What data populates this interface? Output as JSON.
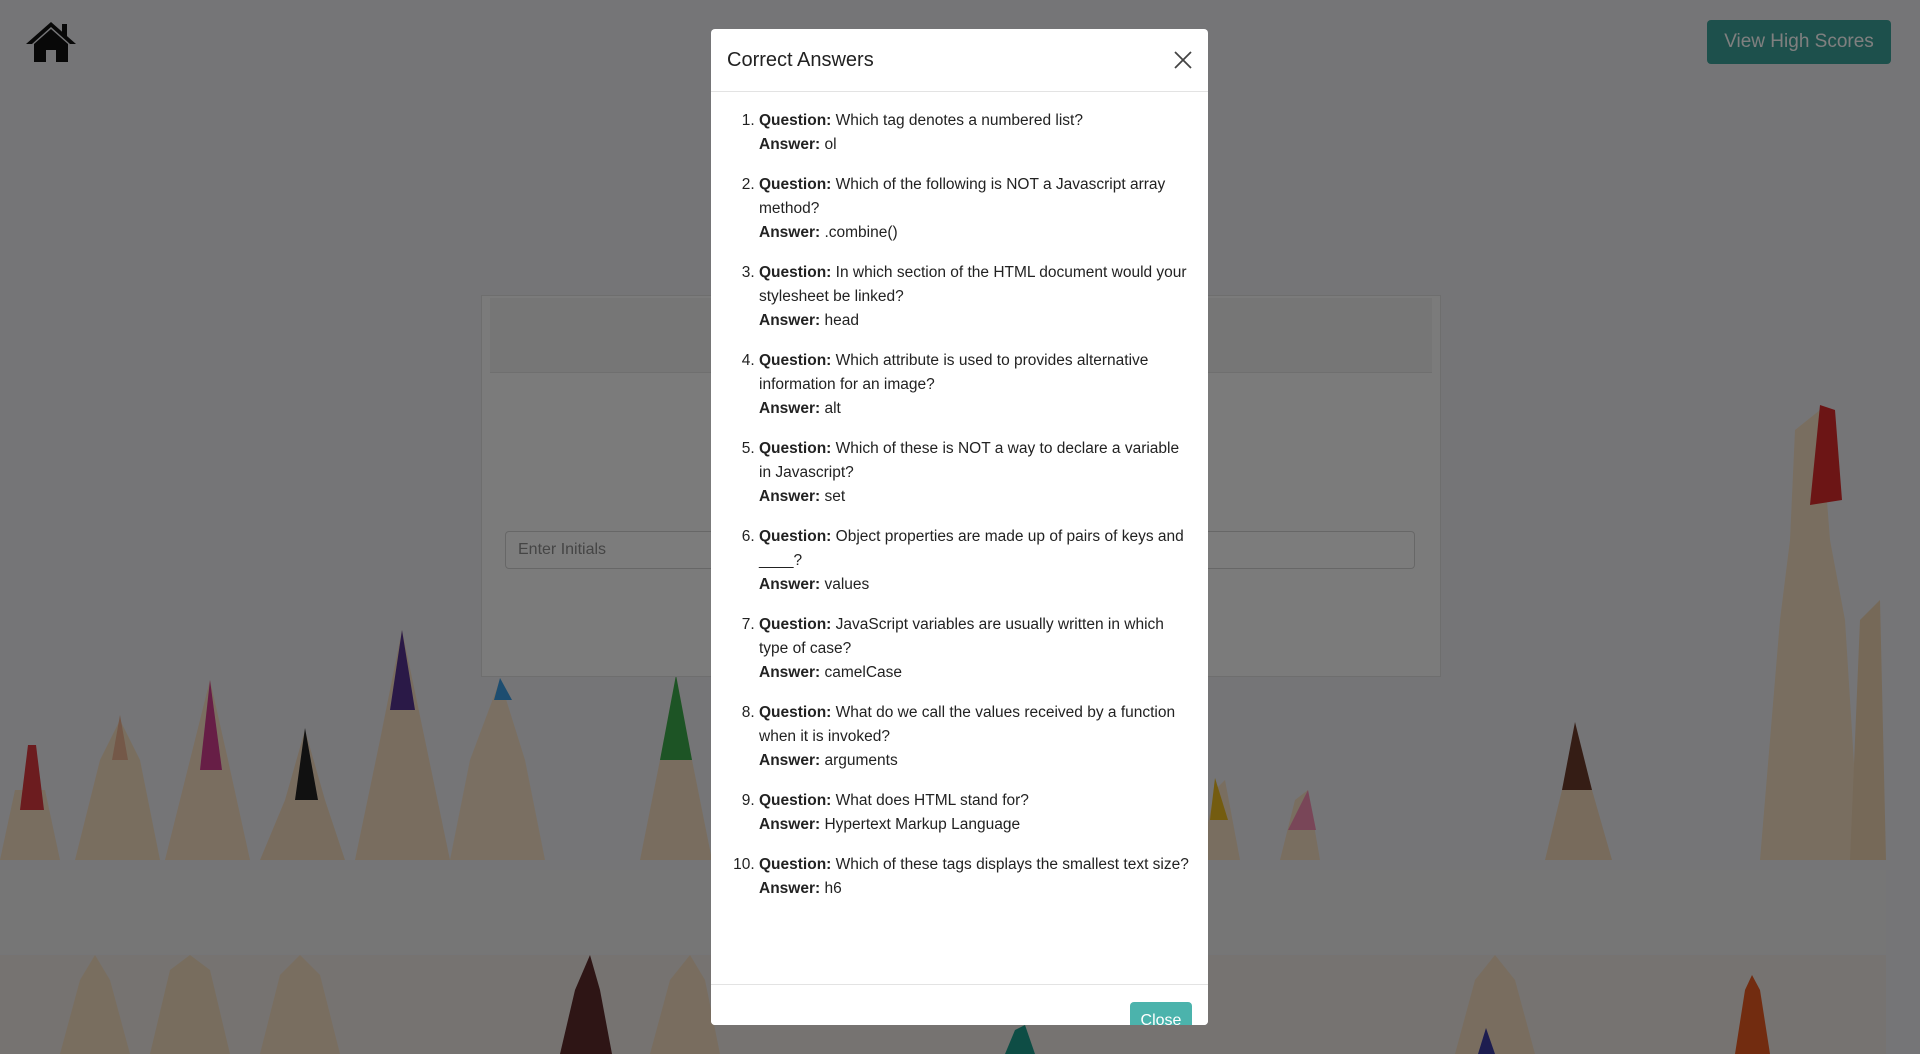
{
  "header": {
    "home_icon": "home-icon",
    "high_scores_label": "View High Scores"
  },
  "card": {
    "initials_placeholder": "Enter Initials"
  },
  "modal": {
    "title": "Correct Answers",
    "close_icon": "close-icon",
    "question_label": "Question:",
    "answer_label": "Answer:",
    "items": [
      {
        "number": "1.",
        "question": "Which tag denotes a numbered list?",
        "answer": "ol"
      },
      {
        "number": "2.",
        "question": "Which of the following is NOT a Javascript array method?",
        "answer": ".combine()"
      },
      {
        "number": "3.",
        "question": "In which section of the HTML document would your stylesheet be linked?",
        "answer": "head"
      },
      {
        "number": "4.",
        "question": "Which attribute is used to provides alternative information for an image?",
        "answer": "alt"
      },
      {
        "number": "5.",
        "question": "Which of these is NOT a way to declare a variable in Javascript?",
        "answer": "set"
      },
      {
        "number": "6.",
        "question": "Object properties are made up of pairs of keys and ____?",
        "answer": "values"
      },
      {
        "number": "7.",
        "question": "JavaScript variables are usually written in which type of case?",
        "answer": "camelCase"
      },
      {
        "number": "8.",
        "question": "What do we call the values received by a function when it is invoked?",
        "answer": "arguments"
      },
      {
        "number": "9.",
        "question": "What does HTML stand for?",
        "answer": "Hypertext Markup Language"
      },
      {
        "number": "10.",
        "question": "Which of these tags displays the smallest text size?",
        "answer": "h6"
      }
    ],
    "close_button_label": "Close"
  },
  "colors": {
    "accent": "#3aa198",
    "close_button": "#4bb3ac",
    "overlay": "rgba(0,0,0,0.5)"
  }
}
